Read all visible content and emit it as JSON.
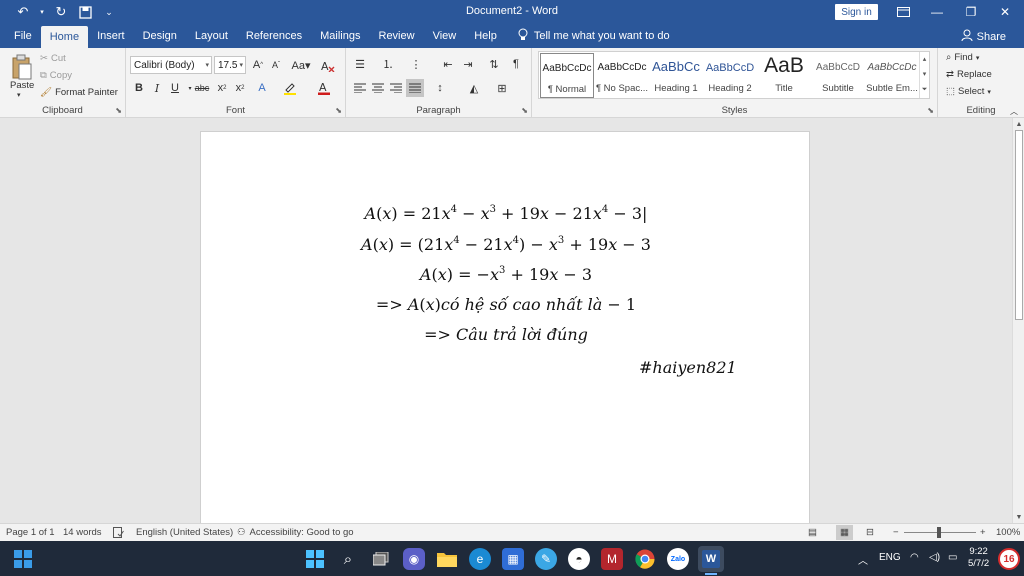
{
  "titlebar": {
    "doc_title": "Document2  -  Word",
    "sign_in": "Sign in"
  },
  "tabs": [
    "File",
    "Home",
    "Insert",
    "Design",
    "Layout",
    "References",
    "Mailings",
    "Review",
    "View",
    "Help"
  ],
  "tell_me": "Tell me what you want to do",
  "share": "Share",
  "clipboard": {
    "paste": "Paste",
    "cut": "Cut",
    "copy": "Copy",
    "format_painter": "Format Painter",
    "label": "Clipboard"
  },
  "font": {
    "family": "Calibri (Body)",
    "size": "17.5",
    "label": "Font"
  },
  "paragraph": {
    "label": "Paragraph"
  },
  "styles": {
    "label": "Styles",
    "items": [
      {
        "preview": "AaBbCcDc",
        "name": "¶ Normal"
      },
      {
        "preview": "AaBbCcDc",
        "name": "¶ No Spac..."
      },
      {
        "preview": "AaBbCc",
        "name": "Heading 1"
      },
      {
        "preview": "AaBbCcD",
        "name": "Heading 2"
      },
      {
        "preview": "AaB",
        "name": "Title"
      },
      {
        "preview": "AaBbCcD",
        "name": "Subtitle"
      },
      {
        "preview": "AaBbCcDc",
        "name": "Subtle Em..."
      }
    ]
  },
  "editing": {
    "find": "Find",
    "replace": "Replace",
    "select": "Select",
    "label": "Editing"
  },
  "document": {
    "signature": "#haiyen821"
  },
  "status": {
    "page": "Page 1 of 1",
    "words": "14 words",
    "language": "English (United States)",
    "accessibility": "Accessibility: Good to go",
    "zoom": "100%"
  },
  "taskbar": {
    "lang": "ENG",
    "time": "9:22",
    "date": "5/7/2",
    "notifications": "16"
  }
}
